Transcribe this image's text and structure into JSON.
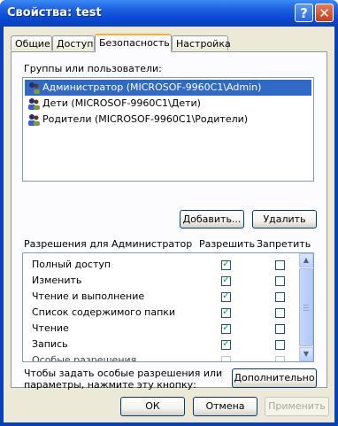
{
  "window": {
    "title": "Свойства: test"
  },
  "title_buttons": {
    "help": "?",
    "close": "✕"
  },
  "tabs": [
    {
      "label": "Общие"
    },
    {
      "label": "Доступ"
    },
    {
      "label": "Безопасность",
      "active": true
    },
    {
      "label": "Настройка"
    }
  ],
  "groups": {
    "label": "Группы или пользователи:",
    "items": [
      {
        "label": "Администратор (MICROSOF-9960C1\\Admin)",
        "selected": true
      },
      {
        "label": "Дети (MICROSOF-9960C1\\Дети)",
        "selected": false
      },
      {
        "label": "Родители (MICROSOF-9960C1\\Родители)",
        "selected": false
      }
    ],
    "add_label": "Добавить...",
    "remove_label": "Удалить"
  },
  "permissions": {
    "title": "Разрешения для Администратор",
    "allow_header": "Разрешить",
    "deny_header": "Запретить",
    "rows": [
      {
        "name": "Полный доступ",
        "allow": true,
        "deny": false
      },
      {
        "name": "Изменить",
        "allow": true,
        "deny": false
      },
      {
        "name": "Чтение и выполнение",
        "allow": true,
        "deny": false
      },
      {
        "name": "Список содержимого папки",
        "allow": true,
        "deny": false
      },
      {
        "name": "Чтение",
        "allow": true,
        "deny": false
      },
      {
        "name": "Запись",
        "allow": true,
        "deny": false
      },
      {
        "name": "Особые разрешения",
        "allow": false,
        "deny": false
      }
    ]
  },
  "advanced": {
    "hint": "Чтобы задать особые разрешения или параметры, нажмите эту кнопку:",
    "hint_line1": "Чтобы задать особые разрешения или",
    "hint_line2": "параметры, нажмите эту кнопку:",
    "button_label": "Дополнительно"
  },
  "footer": {
    "ok_label": "ОК",
    "cancel_label": "Отмена",
    "apply_label": "Применить"
  },
  "colors": {
    "selection": "#316ac5",
    "titlebar": "#0a49d3",
    "check": "#21a121"
  }
}
